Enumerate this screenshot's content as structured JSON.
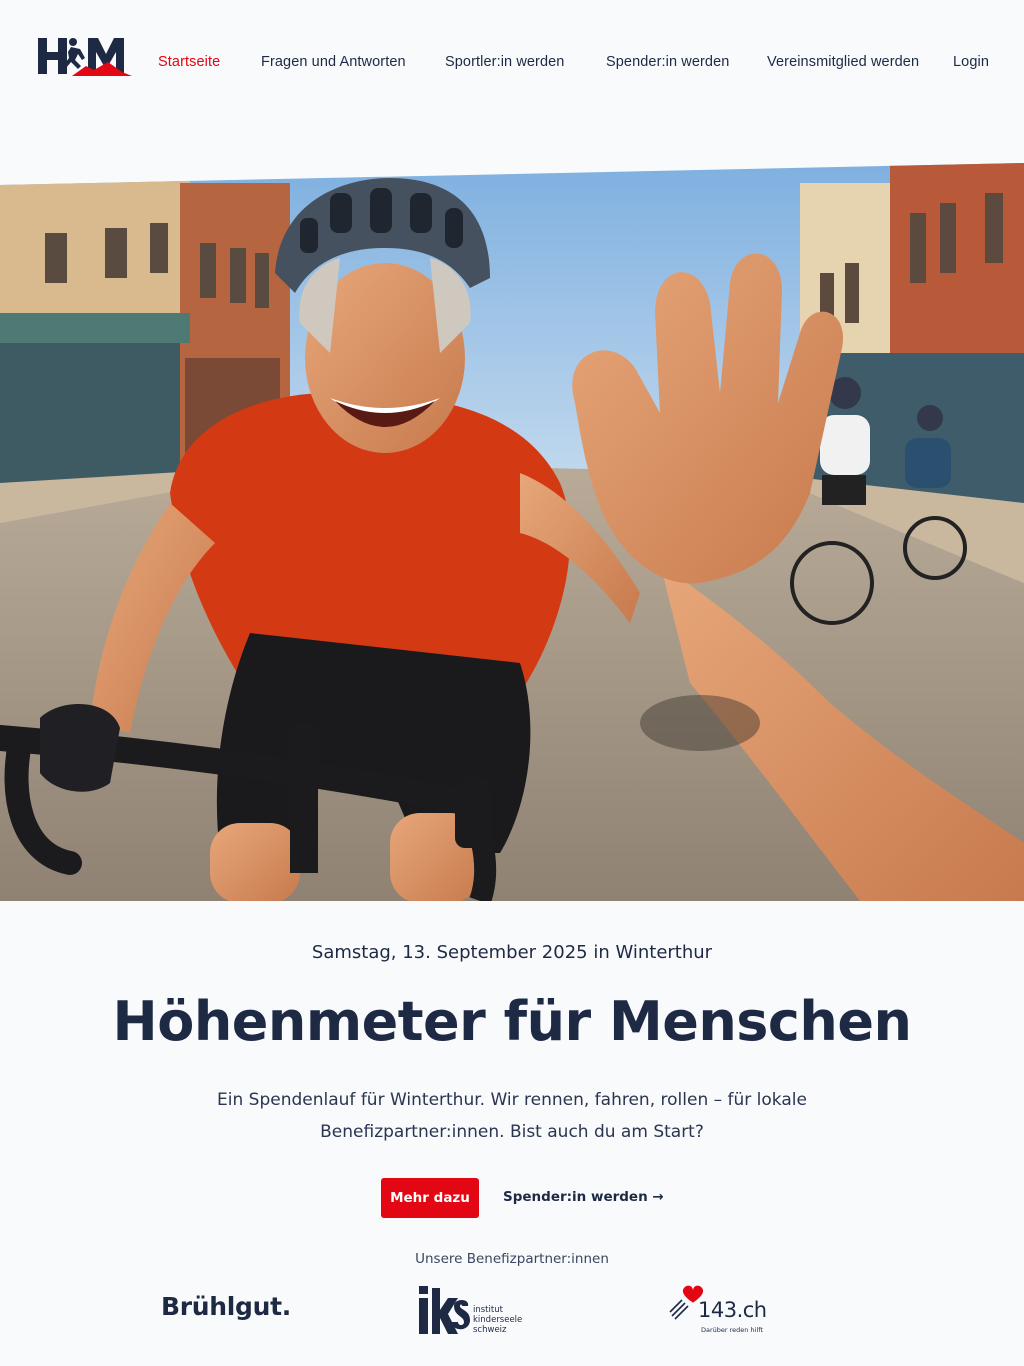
{
  "brand": {
    "logo_text": "HfM"
  },
  "nav": {
    "items": [
      {
        "label": "Startseite",
        "active": true
      },
      {
        "label": "Fragen und Antworten",
        "active": false
      },
      {
        "label": "Sportler:in werden",
        "active": false
      },
      {
        "label": "Spender:in werden",
        "active": false
      },
      {
        "label": "Vereinsmitglied werden",
        "active": false
      },
      {
        "label": "Login",
        "active": false
      }
    ]
  },
  "hero": {
    "date_line": "Samstag, 13. September 2025 in Winterthur",
    "title": "Höhenmeter für Menschen",
    "lead": "Ein Spendenlauf für Winterthur. Wir rennen, fahren, rollen – für lokale Benefizpartner:innen. Bist auch du am Start?",
    "primary_cta": "Mehr dazu",
    "secondary_cta": "Spender:in werden →"
  },
  "partners": {
    "heading": "Unsere Benefizpartner:innen",
    "items": [
      {
        "name": "Brühlgut."
      },
      {
        "name": "iks",
        "lines": [
          "institut",
          "kinderseele",
          "schweiz"
        ]
      },
      {
        "name": "143.ch",
        "tagline": "Darüber reden hilft"
      }
    ]
  },
  "colors": {
    "accent": "#e30613",
    "navy": "#1e2a44",
    "background": "#f8fafc"
  }
}
